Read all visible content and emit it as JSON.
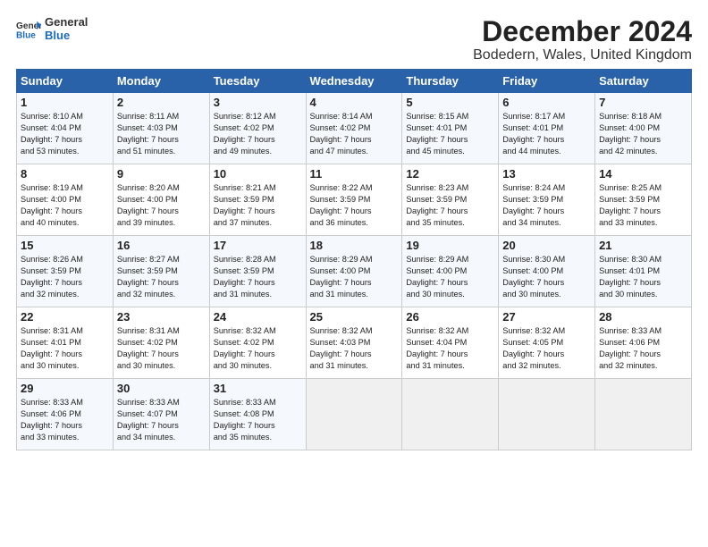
{
  "logo": {
    "line1": "General",
    "line2": "Blue"
  },
  "title": "December 2024",
  "subtitle": "Bodedern, Wales, United Kingdom",
  "days_of_week": [
    "Sunday",
    "Monday",
    "Tuesday",
    "Wednesday",
    "Thursday",
    "Friday",
    "Saturday"
  ],
  "weeks": [
    [
      {
        "day": 1,
        "rise": "8:10 AM",
        "set": "4:04 PM",
        "daylight": "7 hours and 53 minutes."
      },
      {
        "day": 2,
        "rise": "8:11 AM",
        "set": "4:03 PM",
        "daylight": "7 hours and 51 minutes."
      },
      {
        "day": 3,
        "rise": "8:12 AM",
        "set": "4:02 PM",
        "daylight": "7 hours and 49 minutes."
      },
      {
        "day": 4,
        "rise": "8:14 AM",
        "set": "4:02 PM",
        "daylight": "7 hours and 47 minutes."
      },
      {
        "day": 5,
        "rise": "8:15 AM",
        "set": "4:01 PM",
        "daylight": "7 hours and 45 minutes."
      },
      {
        "day": 6,
        "rise": "8:17 AM",
        "set": "4:01 PM",
        "daylight": "7 hours and 44 minutes."
      },
      {
        "day": 7,
        "rise": "8:18 AM",
        "set": "4:00 PM",
        "daylight": "7 hours and 42 minutes."
      }
    ],
    [
      {
        "day": 8,
        "rise": "8:19 AM",
        "set": "4:00 PM",
        "daylight": "7 hours and 40 minutes."
      },
      {
        "day": 9,
        "rise": "8:20 AM",
        "set": "4:00 PM",
        "daylight": "7 hours and 39 minutes."
      },
      {
        "day": 10,
        "rise": "8:21 AM",
        "set": "3:59 PM",
        "daylight": "7 hours and 37 minutes."
      },
      {
        "day": 11,
        "rise": "8:22 AM",
        "set": "3:59 PM",
        "daylight": "7 hours and 36 minutes."
      },
      {
        "day": 12,
        "rise": "8:23 AM",
        "set": "3:59 PM",
        "daylight": "7 hours and 35 minutes."
      },
      {
        "day": 13,
        "rise": "8:24 AM",
        "set": "3:59 PM",
        "daylight": "7 hours and 34 minutes."
      },
      {
        "day": 14,
        "rise": "8:25 AM",
        "set": "3:59 PM",
        "daylight": "7 hours and 33 minutes."
      }
    ],
    [
      {
        "day": 15,
        "rise": "8:26 AM",
        "set": "3:59 PM",
        "daylight": "7 hours and 32 minutes."
      },
      {
        "day": 16,
        "rise": "8:27 AM",
        "set": "3:59 PM",
        "daylight": "7 hours and 32 minutes."
      },
      {
        "day": 17,
        "rise": "8:28 AM",
        "set": "3:59 PM",
        "daylight": "7 hours and 31 minutes."
      },
      {
        "day": 18,
        "rise": "8:29 AM",
        "set": "4:00 PM",
        "daylight": "7 hours and 31 minutes."
      },
      {
        "day": 19,
        "rise": "8:29 AM",
        "set": "4:00 PM",
        "daylight": "7 hours and 30 minutes."
      },
      {
        "day": 20,
        "rise": "8:30 AM",
        "set": "4:00 PM",
        "daylight": "7 hours and 30 minutes."
      },
      {
        "day": 21,
        "rise": "8:30 AM",
        "set": "4:01 PM",
        "daylight": "7 hours and 30 minutes."
      }
    ],
    [
      {
        "day": 22,
        "rise": "8:31 AM",
        "set": "4:01 PM",
        "daylight": "7 hours and 30 minutes."
      },
      {
        "day": 23,
        "rise": "8:31 AM",
        "set": "4:02 PM",
        "daylight": "7 hours and 30 minutes."
      },
      {
        "day": 24,
        "rise": "8:32 AM",
        "set": "4:02 PM",
        "daylight": "7 hours and 30 minutes."
      },
      {
        "day": 25,
        "rise": "8:32 AM",
        "set": "4:03 PM",
        "daylight": "7 hours and 31 minutes."
      },
      {
        "day": 26,
        "rise": "8:32 AM",
        "set": "4:04 PM",
        "daylight": "7 hours and 31 minutes."
      },
      {
        "day": 27,
        "rise": "8:32 AM",
        "set": "4:05 PM",
        "daylight": "7 hours and 32 minutes."
      },
      {
        "day": 28,
        "rise": "8:33 AM",
        "set": "4:06 PM",
        "daylight": "7 hours and 32 minutes."
      }
    ],
    [
      {
        "day": 29,
        "rise": "8:33 AM",
        "set": "4:06 PM",
        "daylight": "7 hours and 33 minutes."
      },
      {
        "day": 30,
        "rise": "8:33 AM",
        "set": "4:07 PM",
        "daylight": "7 hours and 34 minutes."
      },
      {
        "day": 31,
        "rise": "8:33 AM",
        "set": "4:08 PM",
        "daylight": "7 hours and 35 minutes."
      },
      null,
      null,
      null,
      null
    ]
  ]
}
